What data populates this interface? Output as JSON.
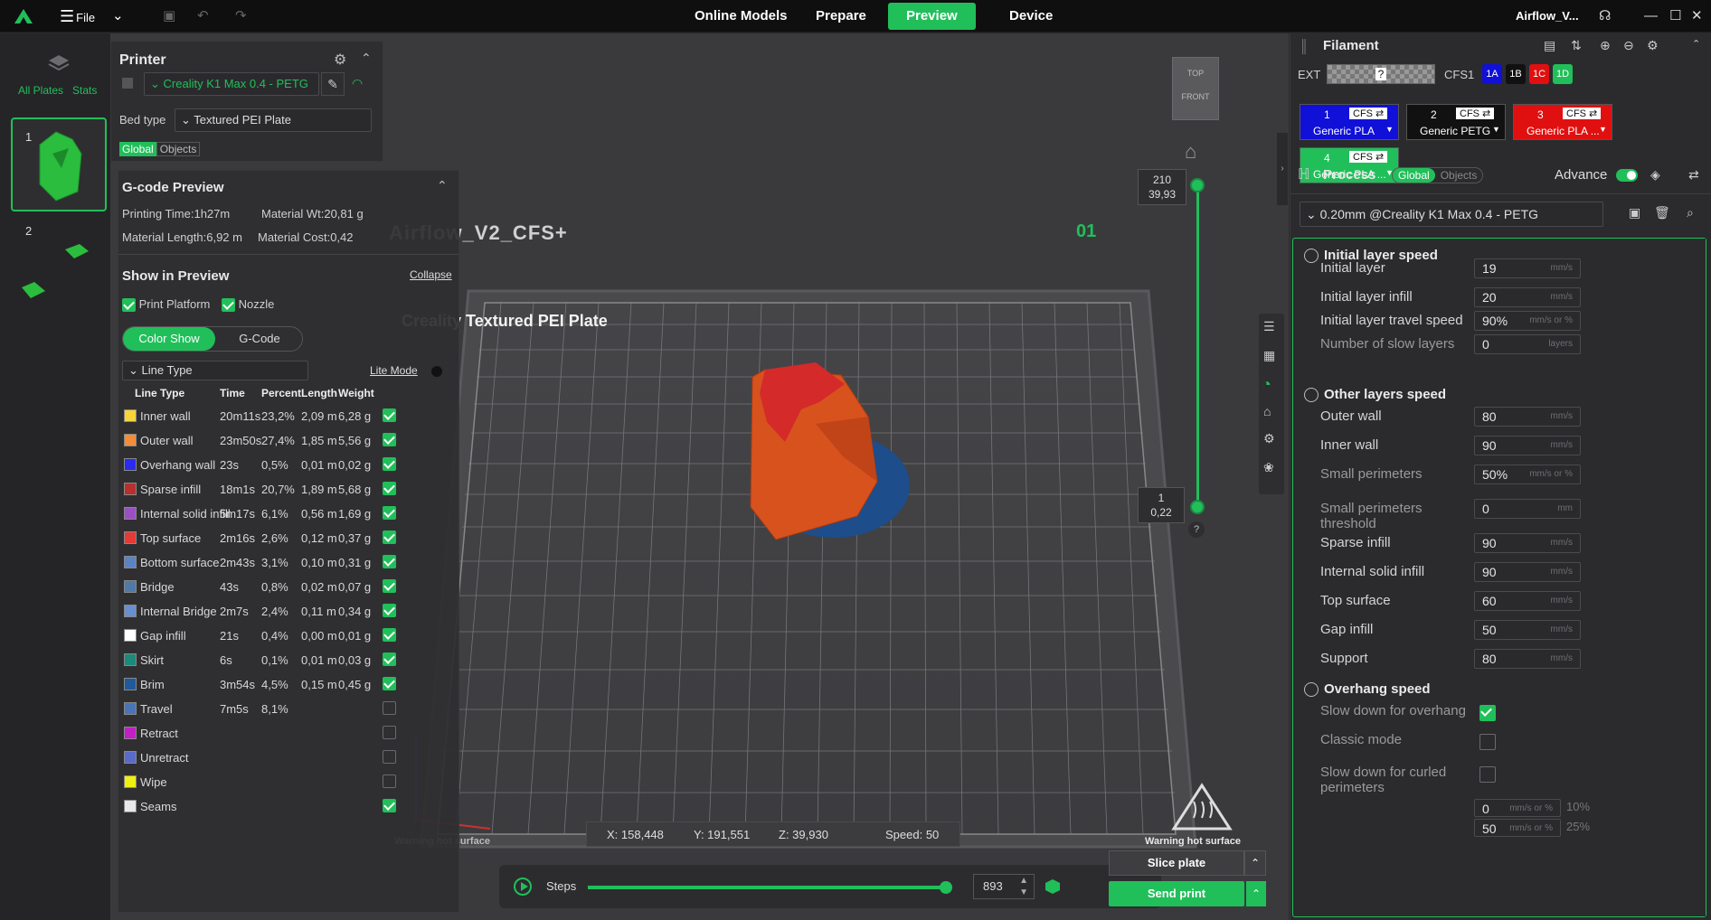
{
  "topbar": {
    "file_label": "File",
    "nav": [
      "Online Models",
      "Prepare",
      "Preview",
      "Device"
    ],
    "active_tab": "Preview",
    "project_name": "Airflow_V...",
    "accent": "#21bf5a"
  },
  "plates": {
    "all_plates": "All Plates",
    "stats": "Stats",
    "plate1_num": "1",
    "plate2_num": "2"
  },
  "printer": {
    "title": "Printer",
    "printer_name": "Creality K1 Max 0.4 - PETG",
    "bed_type_label": "Bed type",
    "bed_type_value": "Textured PEI Plate",
    "tab_global": "Global",
    "tab_objects": "Objects"
  },
  "gcode": {
    "title": "G-code Preview",
    "printing_time": "Printing Time:1h27m",
    "material_wt": "Material Wt:20,81 g",
    "material_length": "Material Length:6,92 m",
    "material_cost": "Material Cost:0,42",
    "show_in_preview": "Show in Preview",
    "collapse": "Collapse",
    "print_platform": "Print Platform",
    "nozzle": "Nozzle",
    "color_show": "Color Show",
    "gcode_btn": "G-Code",
    "line_type_dd": "Line Type",
    "lite_mode": "Lite Mode",
    "headers": [
      "Line Type",
      "Time",
      "Percent",
      "Length",
      "Weight"
    ],
    "rows": [
      {
        "name": "Inner wall",
        "time": "20m11s",
        "pct": "23,2%",
        "len": "2,09 m",
        "wt": "6,28 g",
        "color": "#f5d53a",
        "checked": true
      },
      {
        "name": "Outer wall",
        "time": "23m50s",
        "pct": "27,4%",
        "len": "1,85 m",
        "wt": "5,56 g",
        "color": "#f48d3a",
        "checked": true
      },
      {
        "name": "Overhang wall",
        "time": "23s",
        "pct": "0,5%",
        "len": "0,01 m",
        "wt": "0,02 g",
        "color": "#2a2af0",
        "checked": true
      },
      {
        "name": "Sparse infill",
        "time": "18m1s",
        "pct": "20,7%",
        "len": "1,89 m",
        "wt": "5,68 g",
        "color": "#b8302e",
        "checked": true
      },
      {
        "name": "Internal solid infill",
        "time": "5m17s",
        "pct": "6,1%",
        "len": "0,56 m",
        "wt": "1,69 g",
        "color": "#9b4fc4",
        "checked": true
      },
      {
        "name": "Top surface",
        "time": "2m16s",
        "pct": "2,6%",
        "len": "0,12 m",
        "wt": "0,37 g",
        "color": "#e43a38",
        "checked": true
      },
      {
        "name": "Bottom surface",
        "time": "2m43s",
        "pct": "3,1%",
        "len": "0,10 m",
        "wt": "0,31 g",
        "color": "#5b83c4",
        "checked": true
      },
      {
        "name": "Bridge",
        "time": "43s",
        "pct": "0,8%",
        "len": "0,02 m",
        "wt": "0,07 g",
        "color": "#4f7aa8",
        "checked": true
      },
      {
        "name": "Internal Bridge",
        "time": "2m7s",
        "pct": "2,4%",
        "len": "0,11 m",
        "wt": "0,34 g",
        "color": "#6a8fd0",
        "checked": true
      },
      {
        "name": "Gap infill",
        "time": "21s",
        "pct": "0,4%",
        "len": "0,00 m",
        "wt": "0,01 g",
        "color": "#ffffff",
        "checked": true
      },
      {
        "name": "Skirt",
        "time": "6s",
        "pct": "0,1%",
        "len": "0,01 m",
        "wt": "0,03 g",
        "color": "#1c8a7a",
        "checked": true
      },
      {
        "name": "Brim",
        "time": "3m54s",
        "pct": "4,5%",
        "len": "0,15 m",
        "wt": "0,45 g",
        "color": "#1f5a9a",
        "checked": true
      },
      {
        "name": "Travel",
        "time": "7m5s",
        "pct": "8,1%",
        "len": "",
        "wt": "",
        "color": "#4a74b8",
        "checked": false
      },
      {
        "name": "Retract",
        "time": "",
        "pct": "",
        "len": "",
        "wt": "",
        "color": "#c41fc4",
        "checked": false
      },
      {
        "name": "Unretract",
        "time": "",
        "pct": "",
        "len": "",
        "wt": "",
        "color": "#5a6ac8",
        "checked": false
      },
      {
        "name": "Wipe",
        "time": "",
        "pct": "",
        "len": "",
        "wt": "",
        "color": "#f0f010",
        "checked": false
      },
      {
        "name": "Seams",
        "time": "",
        "pct": "",
        "len": "",
        "wt": "",
        "color": "#e8e8e8",
        "checked": true
      }
    ]
  },
  "viewport": {
    "plate_name": "Airflow_V2_CFS+",
    "plate_number": "01",
    "bed_label": "Creality Textured PEI Plate",
    "cube_top": "TOP",
    "cube_front": "FRONT",
    "layer_top_num": "210",
    "layer_top_h": "39,93",
    "layer_bot_num": "1",
    "layer_bot_h": "0,22",
    "help": "?",
    "coord_x": "X: 158,448",
    "coord_y": "Y: 191,551",
    "coord_z": "Z: 39,930",
    "speed": "Speed: 50",
    "warning": "Warning hot surface",
    "steps_label": "Steps",
    "steps_value": "893",
    "steps_fraction": 0.99,
    "slice_plate": "Slice plate",
    "send_print": "Send print"
  },
  "filament": {
    "title": "Filament",
    "ext_label": "EXT",
    "ext_value": "?",
    "cfs_label": "CFS1",
    "cfs_slots": [
      {
        "label": "1A",
        "color": "#1010d8"
      },
      {
        "label": "1B",
        "color": "#111111"
      },
      {
        "label": "1C",
        "color": "#e01010"
      },
      {
        "label": "1D",
        "color": "#21bf5a"
      }
    ],
    "slots": [
      {
        "num": "1",
        "tag": "CFS",
        "name": "Generic PLA",
        "color": "#1010d8"
      },
      {
        "num": "2",
        "tag": "CFS",
        "name": "Generic PETG",
        "color": "#111111"
      },
      {
        "num": "3",
        "tag": "CFS",
        "name": "Generic PLA ...",
        "color": "#e01010"
      },
      {
        "num": "4",
        "tag": "CFS",
        "name": "Generic PLA ...",
        "color": "#21bf5a"
      }
    ]
  },
  "process": {
    "title": "Process",
    "tab_global": "Global",
    "tab_objects": "Objects",
    "advance": "Advance",
    "preset": "0.20mm @Creality K1 Max 0.4 - PETG",
    "sections": [
      {
        "title": "Initial layer speed",
        "items": [
          {
            "label": "Initial layer",
            "value": "19",
            "unit": "mm/s"
          },
          {
            "label": "Initial layer infill",
            "value": "20",
            "unit": "mm/s"
          },
          {
            "label": "Initial layer travel speed",
            "value": "90%",
            "unit": "mm/s or %"
          },
          {
            "label": "Number of slow layers",
            "value": "0",
            "unit": "layers"
          }
        ]
      },
      {
        "title": "Other layers speed",
        "items": [
          {
            "label": "Outer wall",
            "value": "80",
            "unit": "mm/s"
          },
          {
            "label": "Inner wall",
            "value": "90",
            "unit": "mm/s"
          },
          {
            "label": "Small perimeters",
            "value": "50%",
            "unit": "mm/s or %"
          },
          {
            "label": "Small perimeters threshold",
            "value": "0",
            "unit": "mm"
          },
          {
            "label": "Sparse infill",
            "value": "90",
            "unit": "mm/s"
          },
          {
            "label": "Internal solid infill",
            "value": "90",
            "unit": "mm/s"
          },
          {
            "label": "Top surface",
            "value": "60",
            "unit": "mm/s"
          },
          {
            "label": "Gap infill",
            "value": "50",
            "unit": "mm/s"
          },
          {
            "label": "Support",
            "value": "80",
            "unit": "mm/s"
          }
        ]
      },
      {
        "title": "Overhang speed",
        "items": [
          {
            "label": "Slow down for overhang",
            "checked": true
          },
          {
            "label": "Classic mode",
            "checked": false
          },
          {
            "label": "Slow down for curled perimeters",
            "checked": false
          }
        ]
      }
    ],
    "overhang_rows": [
      {
        "value": "0",
        "unit": "mm/s or %",
        "pct": "10%"
      },
      {
        "value": "50",
        "unit": "mm/s or %",
        "pct": "25%"
      }
    ]
  }
}
